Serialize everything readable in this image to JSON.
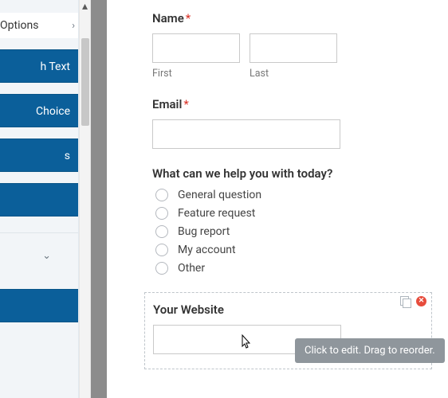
{
  "sidebar": {
    "options_label": "Options",
    "buttons": [
      {
        "label": "h Text"
      },
      {
        "label": "Choice"
      },
      {
        "label": "s"
      },
      {
        "label": ""
      },
      {
        "label": ""
      }
    ]
  },
  "form": {
    "name": {
      "label": "Name",
      "required": "*",
      "first": {
        "value": "",
        "sublabel": "First"
      },
      "last": {
        "value": "",
        "sublabel": "Last"
      }
    },
    "email": {
      "label": "Email",
      "required": "*",
      "value": ""
    },
    "help": {
      "label": "What can we help you with today?",
      "options": [
        "General question",
        "Feature request",
        "Bug report",
        "My account",
        "Other"
      ]
    },
    "website": {
      "label": "Your Website",
      "value": ""
    }
  },
  "tooltip": "Click to edit. Drag to reorder.",
  "icons": {
    "delete_glyph": "✕"
  }
}
